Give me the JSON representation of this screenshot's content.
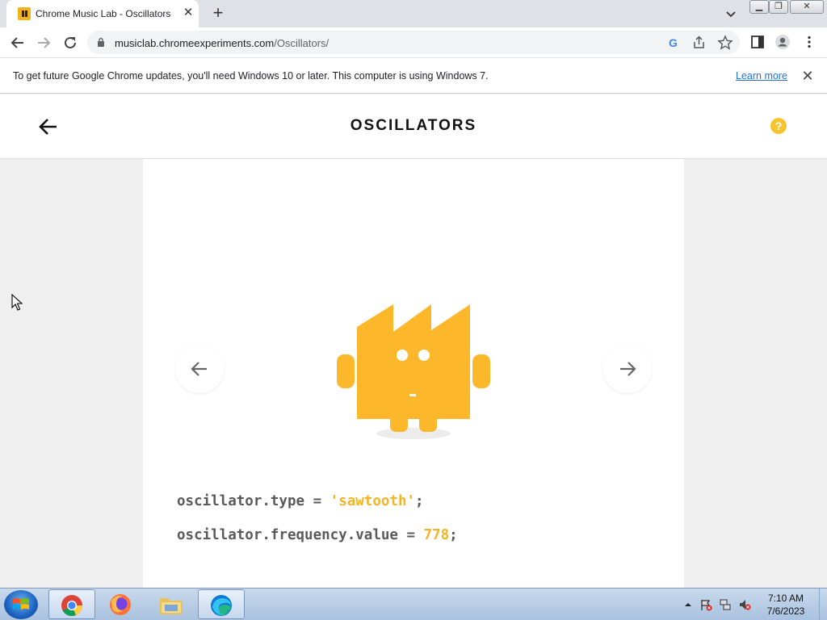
{
  "browser": {
    "tab_title": "Chrome Music Lab - Oscillators",
    "url_domain": "musiclab.chromeexperiments.com",
    "url_path": "/Oscillators/"
  },
  "infobar": {
    "message": "To get future Google Chrome updates, you'll need Windows 10 or later. This computer is using Windows 7.",
    "link": "Learn more"
  },
  "app": {
    "title": "OSCILLATORS",
    "help_symbol": "?",
    "accent_color": "#f4b42a"
  },
  "code": {
    "line1_prefix": "oscillator.type = ",
    "line1_value": "'sawtooth'",
    "line1_suffix": ";",
    "line2_prefix": "oscillator.frequency.value = ",
    "line2_value": "778",
    "line2_suffix": ";"
  },
  "taskbar": {
    "time": "7:10 AM",
    "date": "7/6/2023",
    "apps": [
      "chrome-icon",
      "firefox-icon",
      "file-explorer-icon",
      "edge-icon"
    ]
  }
}
